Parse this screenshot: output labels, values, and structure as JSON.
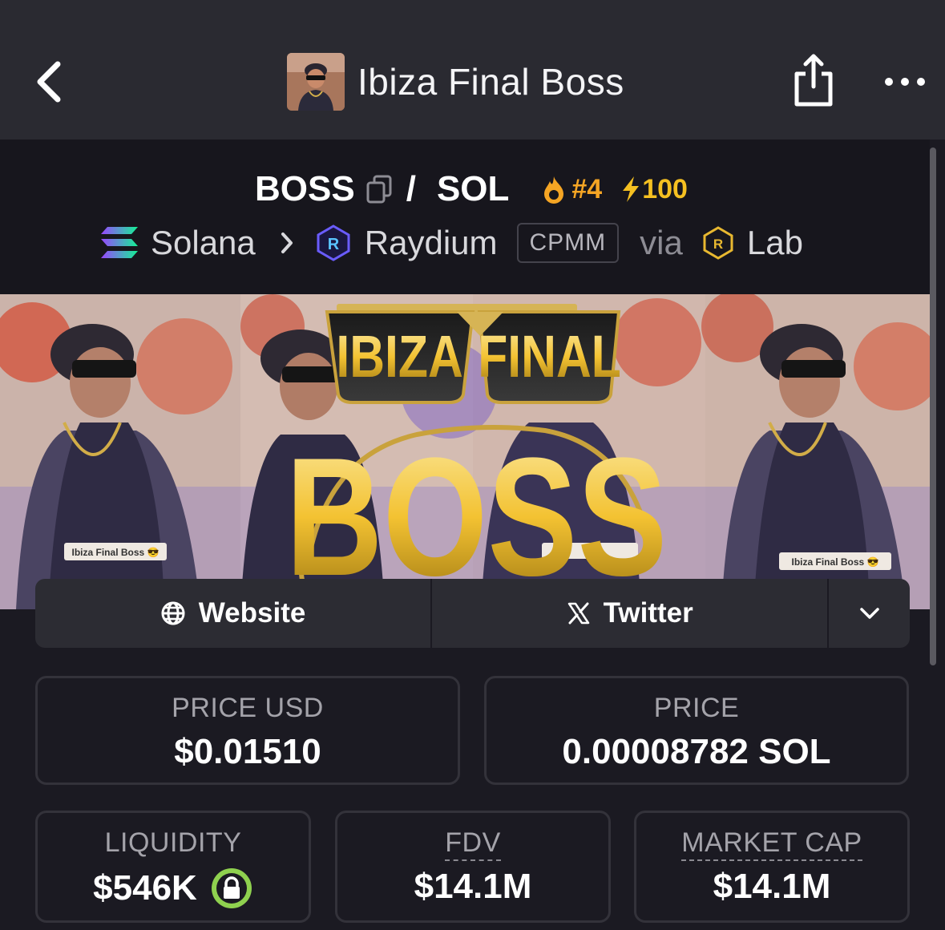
{
  "header": {
    "title": "Ibiza Final Boss",
    "back_icon": "chevron-left-icon",
    "share_icon": "share-icon",
    "more_icon": "more-dots-icon"
  },
  "pair": {
    "base": "BOSS",
    "separator": "/",
    "quote": "SOL",
    "rank": "#4",
    "boost": "100"
  },
  "chain": {
    "chain_name": "Solana",
    "dex_name": "Raydium",
    "pool_type": "CPMM",
    "via": "via",
    "lab": "Lab"
  },
  "banner": {
    "title_word1": "IBIZA",
    "title_word2": "FINAL",
    "title_word3": "BOSS",
    "caption": "Ibiza Final Boss 😎"
  },
  "links": {
    "website": "Website",
    "twitter": "Twitter"
  },
  "stats": {
    "price_usd_label": "PRICE USD",
    "price_usd": "$0.01510",
    "price_label": "PRICE",
    "price": "0.00008782 SOL",
    "liquidity_label": "LIQUIDITY",
    "liquidity": "$546K",
    "fdv_label": "FDV",
    "fdv": "$14.1M",
    "mcap_label": "MARKET CAP",
    "mcap": "$14.1M"
  },
  "colors": {
    "accent_orange": "#f5a524",
    "accent_yellow": "#f5c021",
    "lock_green": "#8fd14f"
  }
}
